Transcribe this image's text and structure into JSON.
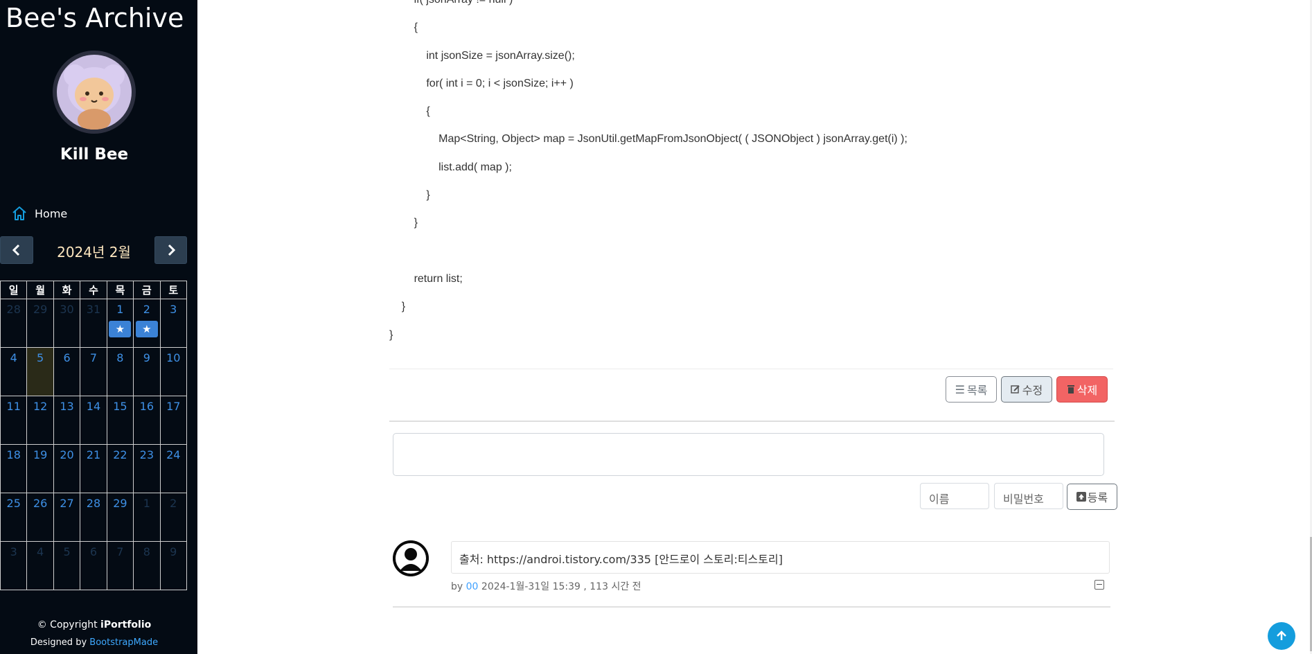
{
  "sidebar": {
    "brand": "Bee's Archive",
    "user_name": "Kill Bee",
    "nav": {
      "home_label": "Home"
    },
    "calendar": {
      "title": "2024년 2월",
      "weekdays": [
        "일",
        "월",
        "화",
        "수",
        "목",
        "금",
        "토"
      ],
      "rows": [
        [
          "28",
          "29",
          "30",
          "31",
          "1",
          "2",
          "3"
        ],
        [
          "4",
          "5",
          "6",
          "7",
          "8",
          "9",
          "10"
        ],
        [
          "11",
          "12",
          "13",
          "14",
          "15",
          "16",
          "17"
        ],
        [
          "18",
          "19",
          "20",
          "21",
          "22",
          "23",
          "24"
        ],
        [
          "25",
          "26",
          "27",
          "28",
          "29",
          "1",
          "2"
        ],
        [
          "3",
          "4",
          "5",
          "6",
          "7",
          "8",
          "9"
        ]
      ],
      "star": "★"
    },
    "footer": {
      "copyright_prefix": "© Copyright",
      "copyright_brand": "iPortfolio",
      "designed_prefix": "Designed by",
      "designed_link": "BootstrapMade"
    }
  },
  "post": {
    "code_lines": [
      "        if( jsonArray != null )",
      "        {",
      "            int jsonSize = jsonArray.size();",
      "            for( int i = 0; i < jsonSize; i++ )",
      "            {",
      "                Map<String, Object> map = JsonUtil.getMapFromJsonObject( ( JSONObject ) jsonArray.get(i) );",
      "                list.add( map );",
      "            }",
      "        }",
      "",
      "        return list;",
      "    }",
      "}"
    ],
    "buttons": {
      "list": "목록",
      "edit": "수정",
      "delete": "삭제"
    }
  },
  "comment_form": {
    "name_placeholder": "이름",
    "password_placeholder": "비밀번호",
    "submit_label": "등록"
  },
  "comments": [
    {
      "content": "출처: https://androi.tistory.com/335 [안드로이 스토리:티스토리]",
      "by": "by",
      "author": "00",
      "meta": "2024-1월-31일 15:39 , 113 시간 전"
    }
  ]
}
